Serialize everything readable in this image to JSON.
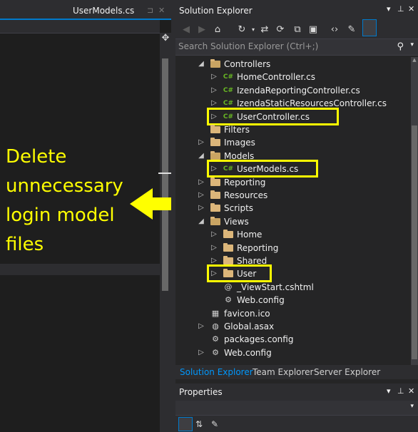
{
  "editor": {
    "tab_title": "UserModels.cs",
    "tab_pin_icon": "pin-icon",
    "tab_close_icon": "close-icon"
  },
  "annotation": {
    "lines": [
      "Delete",
      "unnecessary",
      "login model",
      "files"
    ],
    "color": "#ffff00"
  },
  "solution_explorer": {
    "title": "Solution Explorer",
    "search_placeholder": "Search Solution Explorer (Ctrl+;)",
    "tree": [
      {
        "label": "Controllers",
        "type": "folder-open",
        "level": 0,
        "expand": "open"
      },
      {
        "label": "HomeController.cs",
        "type": "cs",
        "level": 1,
        "expand": "closed"
      },
      {
        "label": "IzendaReportingController.cs",
        "type": "cs",
        "level": 1,
        "expand": "closed"
      },
      {
        "label": "IzendaStaticResourcesController.cs",
        "type": "cs",
        "level": 1,
        "expand": "closed"
      },
      {
        "label": "UserController.cs",
        "type": "cs",
        "level": 1,
        "expand": "closed",
        "highlight": true
      },
      {
        "label": "Filters",
        "type": "folder",
        "level": 0,
        "expand": "none"
      },
      {
        "label": "Images",
        "type": "folder",
        "level": 0,
        "expand": "closed"
      },
      {
        "label": "Models",
        "type": "folder-open",
        "level": 0,
        "expand": "open"
      },
      {
        "label": "UserModels.cs",
        "type": "cs",
        "level": 1,
        "expand": "closed",
        "highlight": true
      },
      {
        "label": "Reporting",
        "type": "folder",
        "level": 0,
        "expand": "closed"
      },
      {
        "label": "Resources",
        "type": "folder",
        "level": 0,
        "expand": "closed"
      },
      {
        "label": "Scripts",
        "type": "folder",
        "level": 0,
        "expand": "closed"
      },
      {
        "label": "Views",
        "type": "folder-open",
        "level": 0,
        "expand": "open"
      },
      {
        "label": "Home",
        "type": "folder",
        "level": 1,
        "expand": "closed"
      },
      {
        "label": "Reporting",
        "type": "folder",
        "level": 1,
        "expand": "closed"
      },
      {
        "label": "Shared",
        "type": "folder",
        "level": 1,
        "expand": "closed"
      },
      {
        "label": "User",
        "type": "folder",
        "level": 1,
        "expand": "closed",
        "highlight": true
      },
      {
        "label": "_ViewStart.cshtml",
        "type": "cshtml",
        "level": 1,
        "expand": "none"
      },
      {
        "label": "Web.config",
        "type": "config",
        "level": 1,
        "expand": "none"
      },
      {
        "label": "favicon.ico",
        "type": "ico",
        "level": 0,
        "expand": "none"
      },
      {
        "label": "Global.asax",
        "type": "asax",
        "level": 0,
        "expand": "closed"
      },
      {
        "label": "packages.config",
        "type": "config",
        "level": 0,
        "expand": "none"
      },
      {
        "label": "Web.config",
        "type": "config",
        "level": 0,
        "expand": "closed"
      }
    ],
    "bottom_tabs": [
      "Solution Explorer",
      "Team Explorer",
      "Server Explorer"
    ]
  },
  "properties": {
    "title": "Properties"
  },
  "colors": {
    "accent": "#007acc",
    "highlight": "#ffff00",
    "folder": "#dcb67a",
    "cs_icon": "#68b723",
    "active_tab_text": "#0097fb"
  }
}
